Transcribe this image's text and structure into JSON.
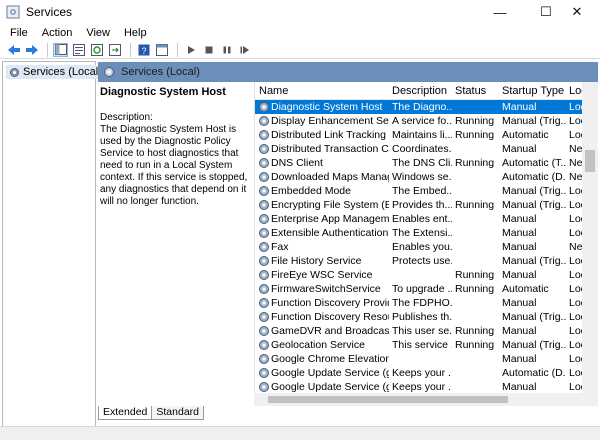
{
  "window": {
    "title": "Services",
    "minimize": "—",
    "maximize": "☐",
    "close": "✕"
  },
  "menu": [
    "File",
    "Action",
    "View",
    "Help"
  ],
  "tree": {
    "root_label": "Services (Local)"
  },
  "header": {
    "label": "Services (Local)"
  },
  "description": {
    "title": "Diagnostic System Host",
    "label": "Description:",
    "text": "The Diagnostic System Host is used by the Diagnostic Policy Service to host diagnostics that need to run in a Local System context.  If this service is stopped, any diagnostics that depend on it will no longer function."
  },
  "table": {
    "columns": [
      "Name",
      "Description",
      "Status",
      "Startup Type",
      "Log"
    ],
    "sort_glyph": "^",
    "rows": [
      {
        "name": "Diagnostic System Host",
        "desc": "The Diagno...",
        "status": "",
        "startup": "Manual",
        "log": "Loc",
        "selected": true
      },
      {
        "name": "Display Enhancement Service",
        "desc": "A service fo...",
        "status": "Running",
        "startup": "Manual (Trig...",
        "log": "Loc"
      },
      {
        "name": "Distributed Link Tracking Cl...",
        "desc": "Maintains li...",
        "status": "Running",
        "startup": "Automatic",
        "log": "Loc"
      },
      {
        "name": "Distributed Transaction Coo...",
        "desc": "Coordinates...",
        "status": "",
        "startup": "Manual",
        "log": "Net"
      },
      {
        "name": "DNS Client",
        "desc": "The DNS Cli...",
        "status": "Running",
        "startup": "Automatic (T...",
        "log": "Net"
      },
      {
        "name": "Downloaded Maps Manager",
        "desc": "Windows se...",
        "status": "",
        "startup": "Automatic (D...",
        "log": "Net"
      },
      {
        "name": "Embedded Mode",
        "desc": "The Embed...",
        "status": "",
        "startup": "Manual (Trig...",
        "log": "Loc"
      },
      {
        "name": "Encrypting File System (EFS)",
        "desc": "Provides th...",
        "status": "Running",
        "startup": "Manual (Trig...",
        "log": "Loc"
      },
      {
        "name": "Enterprise App Managemen...",
        "desc": "Enables ent...",
        "status": "",
        "startup": "Manual",
        "log": "Loc"
      },
      {
        "name": "Extensible Authentication P...",
        "desc": "The Extensi...",
        "status": "",
        "startup": "Manual",
        "log": "Loc"
      },
      {
        "name": "Fax",
        "desc": "Enables you...",
        "status": "",
        "startup": "Manual",
        "log": "Net"
      },
      {
        "name": "File History Service",
        "desc": "Protects use...",
        "status": "",
        "startup": "Manual (Trig...",
        "log": "Loc"
      },
      {
        "name": "FireEye WSC Service",
        "desc": "",
        "status": "Running",
        "startup": "Manual",
        "log": "Loc"
      },
      {
        "name": "FirmwareSwitchService",
        "desc": "To upgrade ...",
        "status": "Running",
        "startup": "Automatic",
        "log": "Loc"
      },
      {
        "name": "Function Discovery Provide...",
        "desc": "The FDPHO...",
        "status": "",
        "startup": "Manual",
        "log": "Loc"
      },
      {
        "name": "Function Discovery Resourc...",
        "desc": "Publishes th...",
        "status": "",
        "startup": "Manual (Trig...",
        "log": "Loc"
      },
      {
        "name": "GameDVR and Broadcast Us...",
        "desc": "This user se...",
        "status": "Running",
        "startup": "Manual",
        "log": "Loc"
      },
      {
        "name": "Geolocation Service",
        "desc": "This service ...",
        "status": "Running",
        "startup": "Manual (Trig...",
        "log": "Loc"
      },
      {
        "name": "Google Chrome Elevation S...",
        "desc": "",
        "status": "",
        "startup": "Manual",
        "log": "Loc"
      },
      {
        "name": "Google Update Service (gup...",
        "desc": "Keeps your ...",
        "status": "",
        "startup": "Automatic (D...",
        "log": "Loc"
      },
      {
        "name": "Google Update Service (gup...",
        "desc": "Keeps your ...",
        "status": "",
        "startup": "Manual",
        "log": "Loc"
      }
    ]
  },
  "tabs": [
    "Extended",
    "Standard"
  ],
  "colors": {
    "selection": "#0078d7",
    "header_bar": "#6a8fb8",
    "tree_selection": "#dfe9f5"
  },
  "icons": [
    "services-app-icon",
    "back-arrow-icon",
    "forward-arrow-icon",
    "show-hide-tree-icon",
    "properties-icon",
    "refresh-icon",
    "export-list-icon",
    "help-icon",
    "console-icon",
    "start-icon",
    "stop-icon",
    "pause-icon",
    "restart-icon",
    "gear-icon"
  ]
}
